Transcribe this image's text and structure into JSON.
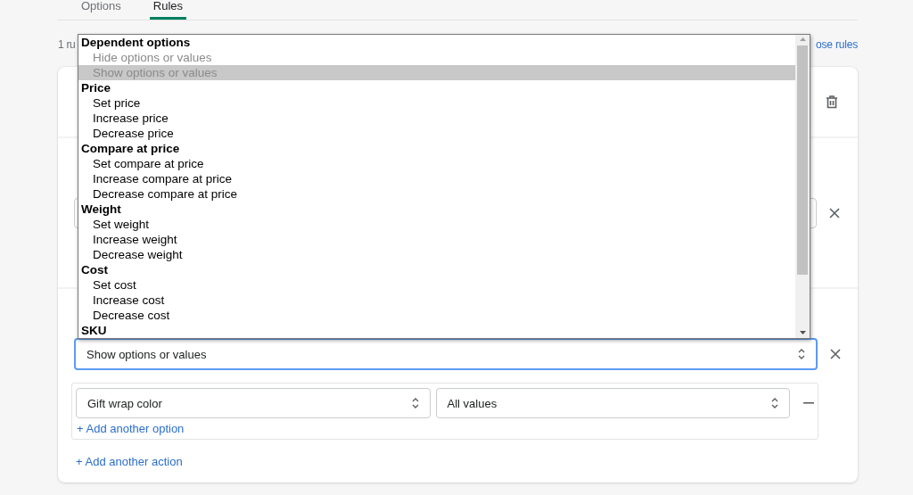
{
  "tabs": [
    {
      "label": "Options",
      "selected": false
    },
    {
      "label": "Rules",
      "selected": true
    }
  ],
  "rules_count": "1 ru",
  "collapse_link": "ose rules",
  "action_select": {
    "value": "Show options or values"
  },
  "dropdown": {
    "groups": [
      {
        "label": "Dependent options",
        "options": [
          {
            "label": "Hide options or values",
            "disabled": true,
            "selected": false
          },
          {
            "label": "Show options or values",
            "disabled": true,
            "selected": true
          }
        ]
      },
      {
        "label": "Price",
        "options": [
          {
            "label": "Set price",
            "disabled": false,
            "selected": false
          },
          {
            "label": "Increase price",
            "disabled": false,
            "selected": false
          },
          {
            "label": "Decrease price",
            "disabled": false,
            "selected": false
          }
        ]
      },
      {
        "label": "Compare at price",
        "options": [
          {
            "label": "Set compare at price",
            "disabled": false,
            "selected": false
          },
          {
            "label": "Increase compare at price",
            "disabled": false,
            "selected": false
          },
          {
            "label": "Decrease compare at price",
            "disabled": false,
            "selected": false
          }
        ]
      },
      {
        "label": "Weight",
        "options": [
          {
            "label": "Set weight",
            "disabled": false,
            "selected": false
          },
          {
            "label": "Increase weight",
            "disabled": false,
            "selected": false
          },
          {
            "label": "Decrease weight",
            "disabled": false,
            "selected": false
          }
        ]
      },
      {
        "label": "Cost",
        "options": [
          {
            "label": "Set cost",
            "disabled": false,
            "selected": false
          },
          {
            "label": "Increase cost",
            "disabled": false,
            "selected": false
          },
          {
            "label": "Decrease cost",
            "disabled": false,
            "selected": false
          }
        ]
      },
      {
        "label": "SKU"
      }
    ]
  },
  "option_row": {
    "option_select": "Gift wrap color",
    "value_select": "All values"
  },
  "add_option_link": "+ Add another option",
  "add_action_link": "+ Add another action"
}
